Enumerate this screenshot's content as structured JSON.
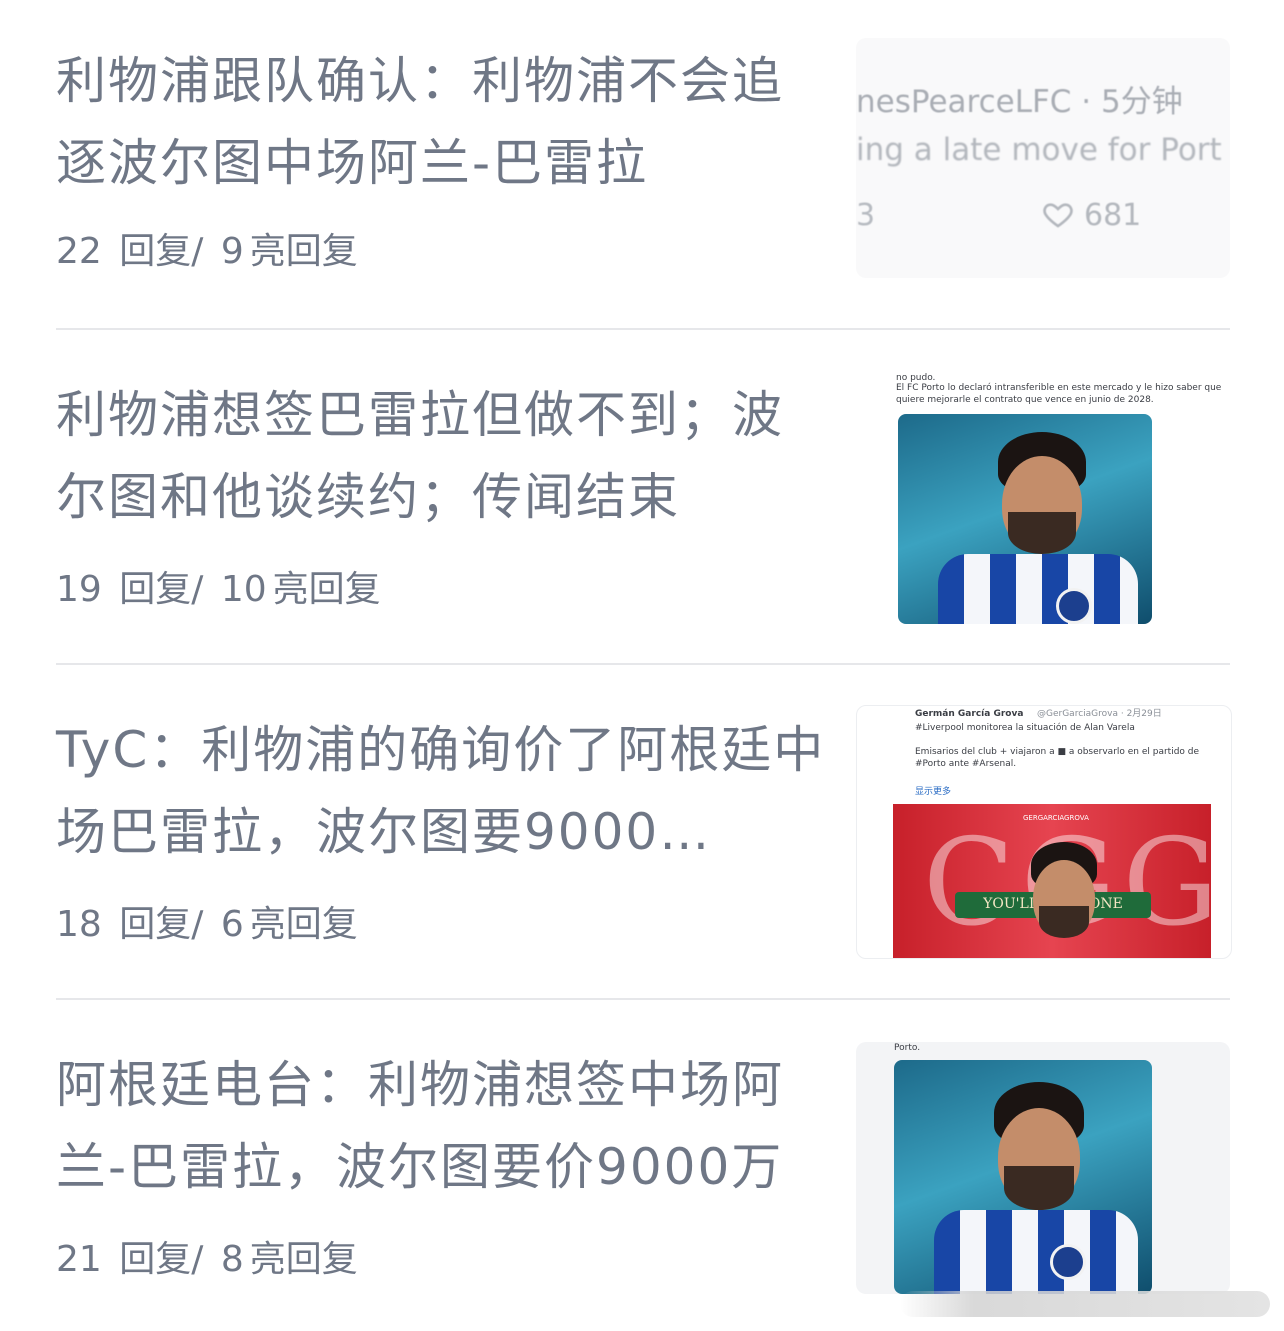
{
  "posts": [
    {
      "title": "利物浦跟队确认：利物浦不会追逐波尔图中场阿兰-巴雷拉",
      "replies": "22",
      "replies_label": "回复/",
      "lights": "9",
      "lights_label": "亮回复",
      "thumb": {
        "tweet_head": "nesPearceLFC · 5分钟",
        "tweet_body": "ing a late move for Port",
        "tweet_count": "3",
        "tweet_likes": "681"
      }
    },
    {
      "title": "利物浦想签巴雷拉但做不到；波尔图和他谈续约；传闻结束",
      "replies": "19",
      "replies_label": "回复/",
      "lights": "10",
      "lights_label": "亮回复",
      "thumb": {
        "caption1": "no pudo.",
        "caption2": "El FC Porto lo declaró intransferible en este mercado y le hizo saber que quiere mejorarle el contrato que vence en junio de 2028."
      }
    },
    {
      "title": "TyC：利物浦的确询价了阿根廷中场巴雷拉，波尔图要9000…",
      "replies": "18",
      "replies_label": "回复/",
      "lights": "6",
      "lights_label": "亮回复",
      "thumb": {
        "author": "Germán García Grova",
        "handle": "@GerGarciaGrova · 2月29日",
        "line1": "#Liverpool monitorea la situación de Alan Varela",
        "line2": "Emisarios del club + viajaron a ■ a observarlo en el partido de #Porto ante #Arsenal.",
        "show_more": "显示更多",
        "banner": "YOU'LL NE      ALONE",
        "big": "CGG",
        "tag": "GERGARCIAGROVA"
      }
    },
    {
      "title": "阿根廷电台：利物浦想签中场阿兰-巴雷拉，波尔图要价9000万",
      "replies": "21",
      "replies_label": "回复/",
      "lights": "8",
      "lights_label": "亮回复",
      "thumb": {
        "caption": "Porto."
      }
    }
  ]
}
